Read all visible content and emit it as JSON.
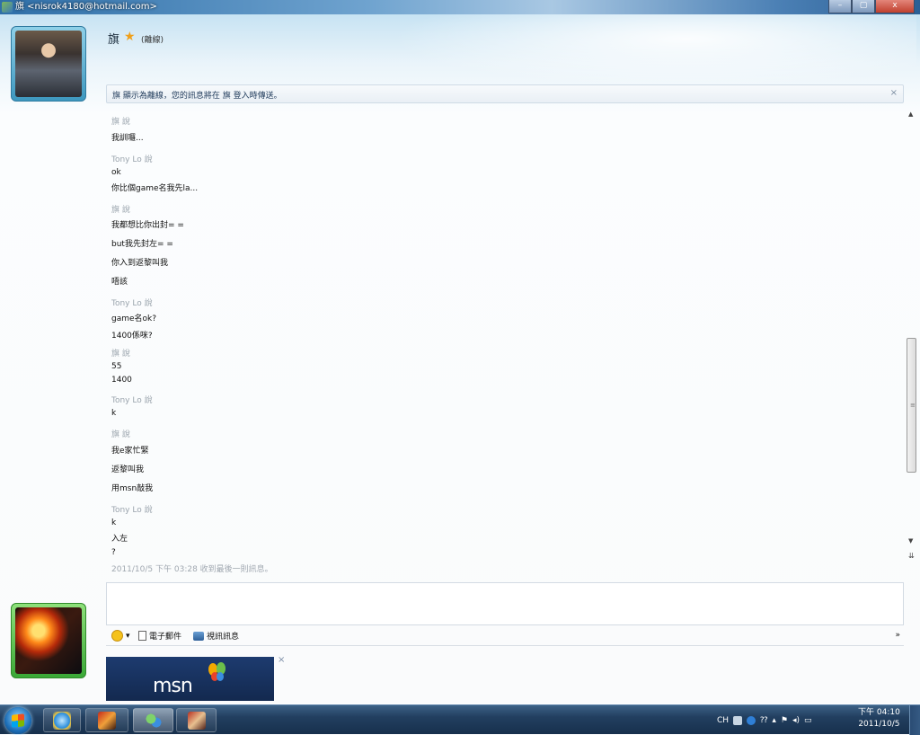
{
  "window": {
    "title": "旗 <nisrok4180@hotmail.com>",
    "minimize": "–",
    "maximize": "▢",
    "close": "x"
  },
  "contact": {
    "name": "旗",
    "status": "(離線)"
  },
  "infobar": {
    "text": "旗 顯示為離線，您的訊息將在 旗 登入時傳送。",
    "close": "×"
  },
  "conversation": [
    {
      "sender": "旗 說",
      "lines": [
        "我訓囉..."
      ]
    },
    {
      "sender": "Tony Lo 說",
      "lines": [
        "ok",
        "你比個game名我先la..."
      ]
    },
    {
      "sender": "旗 說",
      "lines": [
        "我都想比你出封= =",
        "but我先封左= =",
        "你入到返黎叫我",
        "唔該"
      ]
    },
    {
      "sender": "Tony Lo 說",
      "lines": [
        "game名ok?",
        "1400係咪?"
      ]
    },
    {
      "sender": "旗 說",
      "lines": [
        "55",
        "1400"
      ]
    },
    {
      "sender": "Tony Lo 說",
      "lines": [
        "k"
      ]
    },
    {
      "sender": "旗 說",
      "lines": [
        "我e家忙緊",
        "返黎叫我",
        "用msn敲我"
      ]
    },
    {
      "sender": "Tony Lo 說",
      "lines": [
        "k",
        "入左",
        "?"
      ]
    }
  ],
  "timestamp": "2011/10/5 下午 03:28 收到最後一則訊息。",
  "toolbar": {
    "email": "電子郵件",
    "video": "視訊訊息",
    "more": "»"
  },
  "ad": {
    "logo": "msn",
    "close": "×"
  },
  "tray": {
    "lang": "CH"
  },
  "clock": {
    "time": "下午 04:10",
    "date": "2011/10/5"
  },
  "colors": {
    "accent": "#2f6fa8",
    "star": "#f0a01a",
    "user_avatar_frame": "#3aa836",
    "contact_avatar_frame": "#3e98bf"
  }
}
